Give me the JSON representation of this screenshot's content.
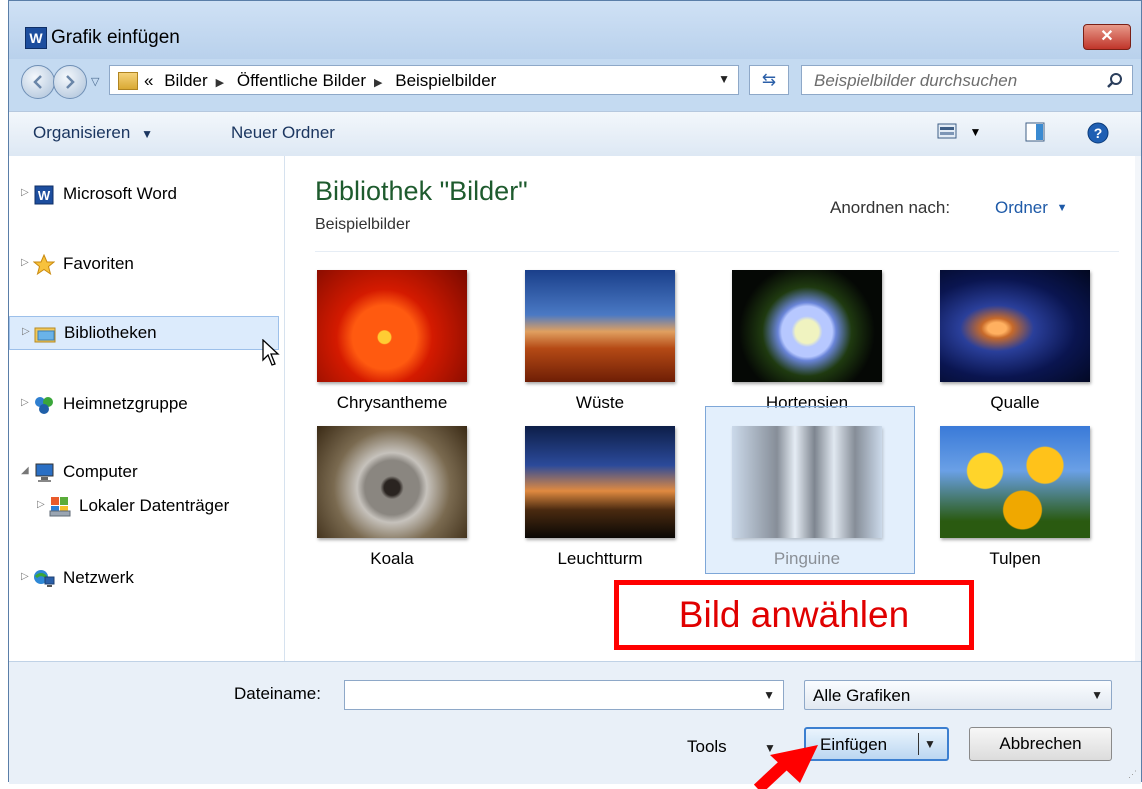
{
  "window": {
    "app_icon_letter": "W",
    "title": "Grafik einfügen",
    "close_label": "✕"
  },
  "navigation": {
    "breadcrumb_overflow": "«",
    "breadcrumbs": [
      "Bilder",
      "Öffentliche Bilder",
      "Beispielbilder"
    ],
    "search_placeholder": "Beispielbilder durchsuchen"
  },
  "toolbar": {
    "organize_label": "Organisieren",
    "new_folder_label": "Neuer Ordner"
  },
  "nav_pane": {
    "items": [
      {
        "label": "Microsoft Word",
        "icon": "word-icon"
      },
      {
        "label": "Favoriten",
        "icon": "star-icon"
      },
      {
        "label": "Bibliotheken",
        "icon": "libraries-icon",
        "selected": true
      },
      {
        "label": "Heimnetzgruppe",
        "icon": "homegroup-icon"
      },
      {
        "label": "Computer",
        "icon": "computer-icon",
        "expanded": true
      },
      {
        "label": "Lokaler Datenträger",
        "icon": "drive-icon"
      },
      {
        "label": "Netzwerk",
        "icon": "network-icon"
      }
    ]
  },
  "content": {
    "library_title": "Bibliothek \"Bilder\"",
    "library_subtitle": "Beispielbilder",
    "arrange_label": "Anordnen nach:",
    "arrange_value": "Ordner",
    "thumbnails": [
      {
        "label": "Chrysantheme"
      },
      {
        "label": "Wüste"
      },
      {
        "label": "Hortensien"
      },
      {
        "label": "Qualle"
      },
      {
        "label": "Koala"
      },
      {
        "label": "Leuchtturm"
      },
      {
        "label": "Pinguine",
        "selected": true
      },
      {
        "label": "Tulpen"
      }
    ]
  },
  "bottom": {
    "filename_label": "Dateiname:",
    "filename_value": "",
    "filetype_value": "Alle Grafiken",
    "tools_label": "Tools",
    "insert_label": "Einfügen",
    "cancel_label": "Abbrechen"
  },
  "annotation": {
    "callout_text": "Bild anwählen",
    "color": "#ff0000"
  },
  "colors": {
    "title_accent": "#1e5b2e",
    "link_blue": "#1e5aa8",
    "selection_blue": "#cce2fa"
  }
}
